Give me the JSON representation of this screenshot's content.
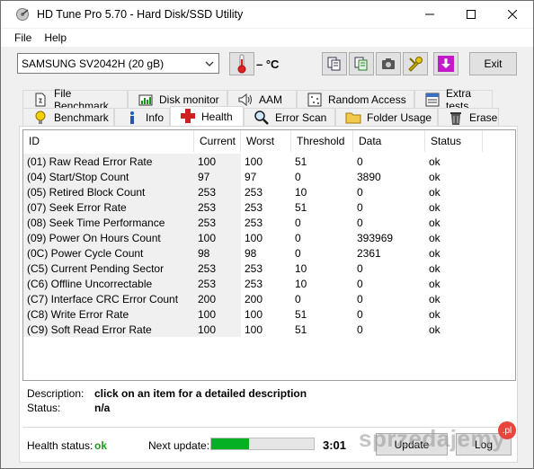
{
  "window": {
    "title": "HD Tune Pro 5.70 - Hard Disk/SSD Utility"
  },
  "menu": {
    "file": "File",
    "help": "Help"
  },
  "toolbar": {
    "drive": "SAMSUNG SV2042H (20 gB)",
    "temperature": "– °C",
    "exit_label": "Exit",
    "icons": [
      "copy-icon",
      "copy-green-icon",
      "camera-icon",
      "tools-icon",
      "download-icon"
    ]
  },
  "tabs": {
    "row1": [
      "File Benchmark",
      "Disk monitor",
      "AAM",
      "Random Access",
      "Extra tests"
    ],
    "row2": [
      "Benchmark",
      "Info",
      "Health",
      "Error Scan",
      "Folder Usage",
      "Erase"
    ],
    "active": "Health"
  },
  "table": {
    "columns": [
      "ID",
      "Current",
      "Worst",
      "Threshold",
      "Data",
      "Status"
    ],
    "rows": [
      [
        "(01) Raw Read Error Rate",
        "100",
        "100",
        "51",
        "0",
        "ok"
      ],
      [
        "(04) Start/Stop Count",
        "97",
        "97",
        "0",
        "3890",
        "ok"
      ],
      [
        "(05) Retired Block Count",
        "253",
        "253",
        "10",
        "0",
        "ok"
      ],
      [
        "(07) Seek Error Rate",
        "253",
        "253",
        "51",
        "0",
        "ok"
      ],
      [
        "(08) Seek Time Performance",
        "253",
        "253",
        "0",
        "0",
        "ok"
      ],
      [
        "(09) Power On Hours Count",
        "100",
        "100",
        "0",
        "393969",
        "ok"
      ],
      [
        "(0C) Power Cycle Count",
        "98",
        "98",
        "0",
        "2361",
        "ok"
      ],
      [
        "(C5) Current Pending Sector",
        "253",
        "253",
        "10",
        "0",
        "ok"
      ],
      [
        "(C6) Offline Uncorrectable",
        "253",
        "253",
        "10",
        "0",
        "ok"
      ],
      [
        "(C7) Interface CRC Error Count",
        "200",
        "200",
        "0",
        "0",
        "ok"
      ],
      [
        "(C8) Write Error Rate",
        "100",
        "100",
        "51",
        "0",
        "ok"
      ],
      [
        "(C9) Soft Read Error Rate",
        "100",
        "100",
        "51",
        "0",
        "ok"
      ]
    ]
  },
  "description": {
    "desc_label": "Description:",
    "desc_value": "click on an item for a detailed description",
    "status_label": "Status:",
    "status_value": "n/a"
  },
  "status": {
    "health_label": "Health status:",
    "health_value": "ok",
    "next_update_label": "Next update:",
    "progress": 0.37,
    "time": "3:01",
    "update_label": "Update",
    "log_label": "Log"
  },
  "watermark": {
    "text": "sprzedajemy",
    "badge": ".pl"
  },
  "colors": {
    "progress_fill": "#06b025",
    "health_ok": "#1c9c1c"
  }
}
